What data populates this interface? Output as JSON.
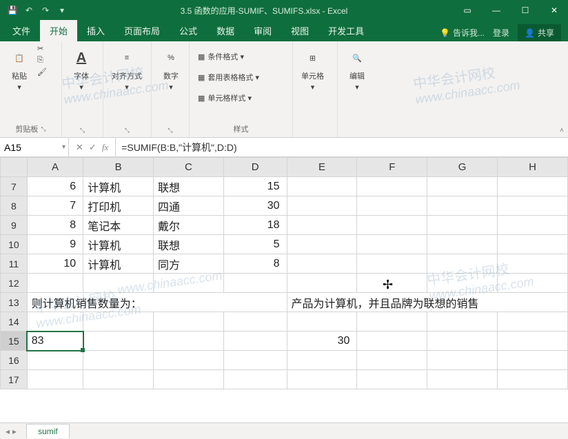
{
  "titlebar": {
    "title": "3.5 函数的应用-SUMIF、SUMIFS.xlsx - Excel"
  },
  "ribbon": {
    "tabs": {
      "file": "文件",
      "home": "开始",
      "insert": "插入",
      "layout": "页面布局",
      "formulas": "公式",
      "data": "数据",
      "review": "审阅",
      "view": "视图",
      "developer": "开发工具"
    },
    "tell_me": "告诉我...",
    "sign_in": "登录",
    "share": "共享",
    "groups": {
      "clipboard": {
        "label": "剪贴板",
        "paste": "粘贴"
      },
      "font": {
        "label": "字体"
      },
      "alignment": {
        "label": "对齐方式"
      },
      "number": {
        "label": "数字"
      },
      "styles": {
        "label": "样式",
        "cond_format": "条件格式 ▾",
        "table_format": "套用表格格式 ▾",
        "cell_styles": "单元格样式 ▾"
      },
      "cells": {
        "label": "单元格"
      },
      "editing": {
        "label": "编辑"
      }
    }
  },
  "formula_bar": {
    "name_box": "A15",
    "formula": "=SUMIF(B:B,\"计算机\",D:D)"
  },
  "columns": [
    "A",
    "B",
    "C",
    "D",
    "E",
    "F",
    "G",
    "H"
  ],
  "rows": [
    {
      "n": "7",
      "A": "6",
      "B": "计算机",
      "C": "联想",
      "D": "15"
    },
    {
      "n": "8",
      "A": "7",
      "B": "打印机",
      "C": "四通",
      "D": "30"
    },
    {
      "n": "9",
      "A": "8",
      "B": "笔记本",
      "C": "戴尔",
      "D": "18"
    },
    {
      "n": "10",
      "A": "9",
      "B": "计算机",
      "C": "联想",
      "D": "5"
    },
    {
      "n": "11",
      "A": "10",
      "B": "计算机",
      "C": "同方",
      "D": "8"
    },
    {
      "n": "12"
    },
    {
      "n": "13",
      "A_span": "则计算机销售数量为：",
      "E_span": "产品为计算机，并且品牌为联想的销售"
    },
    {
      "n": "14"
    },
    {
      "n": "15",
      "A": "83",
      "E": "30",
      "selected": true
    },
    {
      "n": "16"
    },
    {
      "n": "17"
    }
  ],
  "sheet": {
    "name": "sumif"
  },
  "watermark": {
    "line1": "中华会计网校",
    "line2": "www.chinaacc.com"
  }
}
